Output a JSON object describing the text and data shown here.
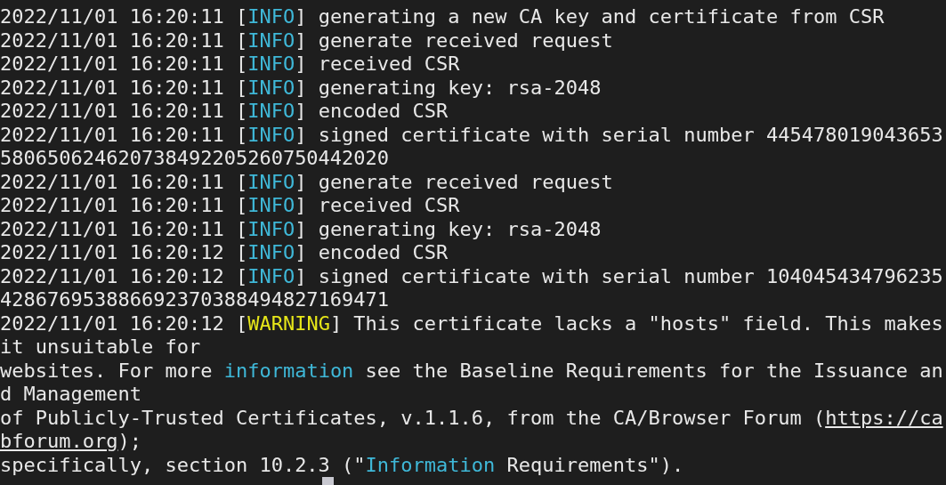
{
  "terminal": {
    "lines": [
      {
        "segments": [
          {
            "kind": "plain",
            "text": "2022/11/01 16:20:11 ["
          },
          {
            "kind": "info",
            "text": "INFO"
          },
          {
            "kind": "plain",
            "text": "] generating a new CA key and certificate from CSR"
          }
        ]
      },
      {
        "segments": [
          {
            "kind": "plain",
            "text": "2022/11/01 16:20:11 ["
          },
          {
            "kind": "info",
            "text": "INFO"
          },
          {
            "kind": "plain",
            "text": "] generate received request"
          }
        ]
      },
      {
        "segments": [
          {
            "kind": "plain",
            "text": "2022/11/01 16:20:11 ["
          },
          {
            "kind": "info",
            "text": "INFO"
          },
          {
            "kind": "plain",
            "text": "] received CSR"
          }
        ]
      },
      {
        "segments": [
          {
            "kind": "plain",
            "text": "2022/11/01 16:20:11 ["
          },
          {
            "kind": "info",
            "text": "INFO"
          },
          {
            "kind": "plain",
            "text": "] generating key: rsa-2048"
          }
        ]
      },
      {
        "segments": [
          {
            "kind": "plain",
            "text": "2022/11/01 16:20:11 ["
          },
          {
            "kind": "info",
            "text": "INFO"
          },
          {
            "kind": "plain",
            "text": "] encoded CSR"
          }
        ]
      },
      {
        "segments": [
          {
            "kind": "plain",
            "text": "2022/11/01 16:20:11 ["
          },
          {
            "kind": "info",
            "text": "INFO"
          },
          {
            "kind": "plain",
            "text": "] signed certificate with serial number 445478019043653"
          }
        ]
      },
      {
        "segments": [
          {
            "kind": "plain",
            "text": "580650624620738492205260750442020"
          }
        ]
      },
      {
        "segments": [
          {
            "kind": "plain",
            "text": "2022/11/01 16:20:11 ["
          },
          {
            "kind": "info",
            "text": "INFO"
          },
          {
            "kind": "plain",
            "text": "] generate received request"
          }
        ]
      },
      {
        "segments": [
          {
            "kind": "plain",
            "text": "2022/11/01 16:20:11 ["
          },
          {
            "kind": "info",
            "text": "INFO"
          },
          {
            "kind": "plain",
            "text": "] received CSR"
          }
        ]
      },
      {
        "segments": [
          {
            "kind": "plain",
            "text": "2022/11/01 16:20:11 ["
          },
          {
            "kind": "info",
            "text": "INFO"
          },
          {
            "kind": "plain",
            "text": "] generating key: rsa-2048"
          }
        ]
      },
      {
        "segments": [
          {
            "kind": "plain",
            "text": "2022/11/01 16:20:12 ["
          },
          {
            "kind": "info",
            "text": "INFO"
          },
          {
            "kind": "plain",
            "text": "] encoded CSR"
          }
        ]
      },
      {
        "segments": [
          {
            "kind": "plain",
            "text": "2022/11/01 16:20:12 ["
          },
          {
            "kind": "info",
            "text": "INFO"
          },
          {
            "kind": "plain",
            "text": "] signed certificate with serial number 104045434796235"
          }
        ]
      },
      {
        "segments": [
          {
            "kind": "plain",
            "text": "428676953886692370388494827169471"
          }
        ]
      },
      {
        "segments": [
          {
            "kind": "plain",
            "text": "2022/11/01 16:20:12 ["
          },
          {
            "kind": "warning",
            "text": "WARNING"
          },
          {
            "kind": "plain",
            "text": "] This certificate lacks a \"hosts\" field. This makes"
          }
        ]
      },
      {
        "segments": [
          {
            "kind": "plain",
            "text": " it unsuitable for"
          }
        ]
      },
      {
        "segments": [
          {
            "kind": "plain",
            "text": "websites. For more "
          },
          {
            "kind": "keyword",
            "text": "information"
          },
          {
            "kind": "plain",
            "text": " see the Baseline Requirements for the Issuance an"
          }
        ]
      },
      {
        "segments": [
          {
            "kind": "plain",
            "text": "d Management"
          }
        ]
      },
      {
        "segments": [
          {
            "kind": "plain",
            "text": "of Publicly-Trusted Certificates, v.1.1.6, from the CA/Browser Forum ("
          },
          {
            "kind": "link",
            "text": "https://ca"
          }
        ]
      },
      {
        "segments": [
          {
            "kind": "link",
            "text": "bforum.org"
          },
          {
            "kind": "plain",
            "text": ");"
          }
        ]
      },
      {
        "segments": [
          {
            "kind": "plain",
            "text": "specifically, section 10.2.3 (\""
          },
          {
            "kind": "keyword",
            "text": "Information"
          },
          {
            "kind": "plain",
            "text": " Requirements\")."
          }
        ]
      }
    ]
  }
}
